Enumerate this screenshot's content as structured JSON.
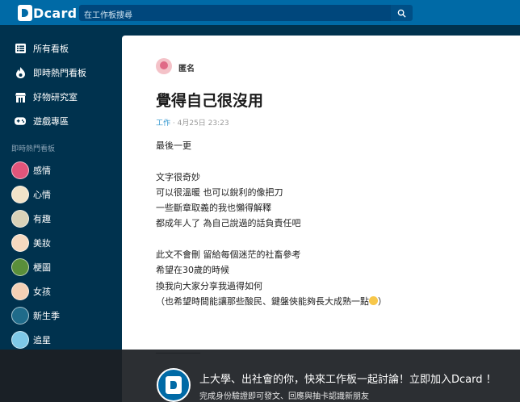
{
  "header": {
    "logo_text": "Dcard",
    "search_placeholder": "在工作板搜尋"
  },
  "sidebar": {
    "nav": [
      {
        "label": "所有看板",
        "icon": "list-icon"
      },
      {
        "label": "即時熱門看板",
        "icon": "flame-icon"
      },
      {
        "label": "好物研究室",
        "icon": "store-icon"
      },
      {
        "label": "遊戲專區",
        "icon": "gamepad-icon"
      }
    ],
    "section_title": "即時熱門看板",
    "boards": [
      {
        "label": "感情",
        "color": "#e2557b"
      },
      {
        "label": "心情",
        "color": "#f1e3c9"
      },
      {
        "label": "有趣",
        "color": "#d9d2b8"
      },
      {
        "label": "美妝",
        "color": "#f6d9c0"
      },
      {
        "label": "梗圖",
        "color": "#5a8f3a"
      },
      {
        "label": "女孩",
        "color": "#f3d1b6"
      },
      {
        "label": "新生季",
        "color": "#1f6b8a"
      },
      {
        "label": "追星",
        "color": "#7ec9e8"
      }
    ]
  },
  "post": {
    "author": "匿名",
    "title": "覺得自己很沒用",
    "category": "工作",
    "timestamp": "4月25日 23:23",
    "lines": [
      "最後一更",
      "",
      "文字很奇妙",
      "可以很溫暖 也可以銳利的像把刀",
      "一些斷章取義的我也懶得解釋",
      "都成年人了 為自己說過的話負責任吧",
      "",
      "此文不會刪 留給每個迷茫的社畜參考",
      "希望在30歲的時候",
      "換我向大家分享我過得如何",
      "（也希望時間能讓那些酸民、鍵盤俠能夠長大成熟一點",
      "",
      "",
      "__________"
    ]
  },
  "banner": {
    "title": "上大學、出社會的你，快來工作板一起討論！立即加入Dcard ！",
    "subtitle": "完成身份驗證即可發文、回應與抽卡認識新朋友"
  }
}
